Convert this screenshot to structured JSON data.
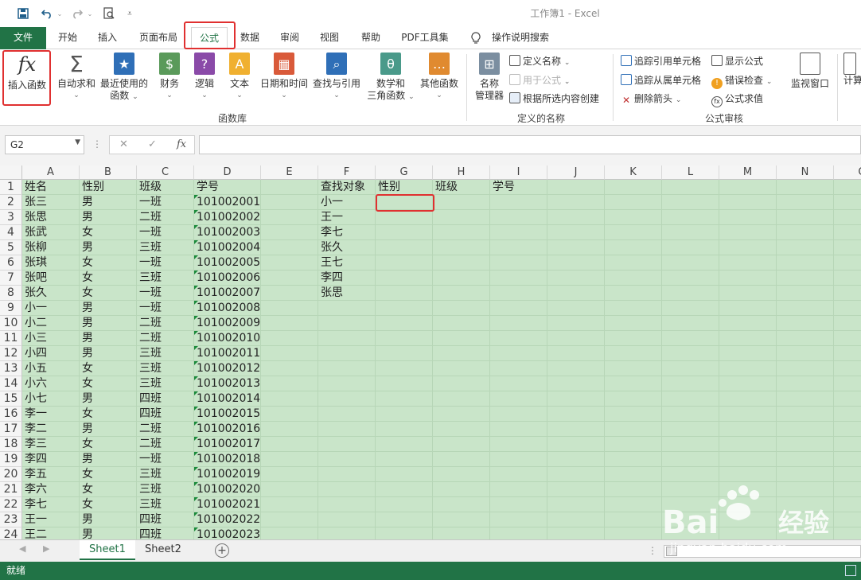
{
  "app": {
    "title": "工作簿1  -  Excel"
  },
  "quick_access": {
    "save": "save-icon",
    "undo": "undo-icon",
    "redo": "redo-icon",
    "preview": "print-preview-icon",
    "customize": "customize-icon"
  },
  "tabs": [
    "文件",
    "开始",
    "插入",
    "页面布局",
    "公式",
    "数据",
    "审阅",
    "视图",
    "帮助",
    "PDF工具集"
  ],
  "active_tab": "公式",
  "tell_me": "操作说明搜索",
  "ribbon": {
    "function_library": {
      "label": "函数库",
      "insert_function": "插入函数",
      "autosum": "自动求和",
      "recent_line1": "最近使用的",
      "recent_line2": "函数",
      "financial": "财务",
      "logical": "逻辑",
      "text": "文本",
      "datetime": "日期和时间",
      "lookup": "查找与引用",
      "math_line1": "数学和",
      "math_line2": "三角函数",
      "more": "其他函数"
    },
    "defined_names": {
      "label": "定义的名称",
      "name_manager_line1": "名称",
      "name_manager_line2": "管理器",
      "define_name": "定义名称",
      "use_in_formula": "用于公式",
      "create_from_selection": "根据所选内容创建"
    },
    "formula_auditing": {
      "label": "公式审核",
      "trace_precedents": "追踪引用单元格",
      "trace_dependents": "追踪从属单元格",
      "remove_arrows": "删除箭头",
      "show_formulas": "显示公式",
      "error_checking": "错误检查",
      "evaluate_formula": "公式求值",
      "watch_window": "监视窗口",
      "calc_partial": "计算"
    }
  },
  "formula_bar": {
    "name_box": "G2",
    "cancel": "✕",
    "enter": "✓",
    "fx": "fx",
    "value": ""
  },
  "columns": [
    "A",
    "B",
    "C",
    "D",
    "E",
    "F",
    "G",
    "H",
    "I",
    "J",
    "K",
    "L",
    "M",
    "N",
    "O"
  ],
  "rows": [
    {
      "n": "1",
      "A": "姓名",
      "B": "性别",
      "C": "班级",
      "D": "学号",
      "F": "查找对象",
      "G": "性别",
      "H": "班级",
      "I": "学号"
    },
    {
      "n": "2",
      "A": "张三",
      "B": "男",
      "C": "一班",
      "D": "101002001",
      "F": "小一"
    },
    {
      "n": "3",
      "A": "张思",
      "B": "男",
      "C": "二班",
      "D": "101002002",
      "F": "王一"
    },
    {
      "n": "4",
      "A": "张武",
      "B": "女",
      "C": "一班",
      "D": "101002003",
      "F": "李七"
    },
    {
      "n": "5",
      "A": "张柳",
      "B": "男",
      "C": "三班",
      "D": "101002004",
      "F": "张久"
    },
    {
      "n": "6",
      "A": "张琪",
      "B": "女",
      "C": "一班",
      "D": "101002005",
      "F": "王七"
    },
    {
      "n": "7",
      "A": "张吧",
      "B": "女",
      "C": "三班",
      "D": "101002006",
      "F": "李四"
    },
    {
      "n": "8",
      "A": "张久",
      "B": "女",
      "C": "一班",
      "D": "101002007",
      "F": "张思"
    },
    {
      "n": "9",
      "A": "小一",
      "B": "男",
      "C": "一班",
      "D": "101002008"
    },
    {
      "n": "10",
      "A": "小二",
      "B": "男",
      "C": "二班",
      "D": "101002009"
    },
    {
      "n": "11",
      "A": "小三",
      "B": "男",
      "C": "二班",
      "D": "101002010"
    },
    {
      "n": "12",
      "A": "小四",
      "B": "男",
      "C": "三班",
      "D": "101002011"
    },
    {
      "n": "13",
      "A": "小五",
      "B": "女",
      "C": "三班",
      "D": "101002012"
    },
    {
      "n": "14",
      "A": "小六",
      "B": "女",
      "C": "三班",
      "D": "101002013"
    },
    {
      "n": "15",
      "A": "小七",
      "B": "男",
      "C": "四班",
      "D": "101002014"
    },
    {
      "n": "16",
      "A": "李一",
      "B": "女",
      "C": "四班",
      "D": "101002015"
    },
    {
      "n": "17",
      "A": "李二",
      "B": "男",
      "C": "二班",
      "D": "101002016"
    },
    {
      "n": "18",
      "A": "李三",
      "B": "女",
      "C": "二班",
      "D": "101002017"
    },
    {
      "n": "19",
      "A": "李四",
      "B": "男",
      "C": "一班",
      "D": "101002018"
    },
    {
      "n": "20",
      "A": "李五",
      "B": "女",
      "C": "三班",
      "D": "101002019"
    },
    {
      "n": "21",
      "A": "李六",
      "B": "女",
      "C": "三班",
      "D": "101002020"
    },
    {
      "n": "22",
      "A": "李七",
      "B": "女",
      "C": "三班",
      "D": "101002021"
    },
    {
      "n": "23",
      "A": "王一",
      "B": "男",
      "C": "四班",
      "D": "101002022"
    },
    {
      "n": "24",
      "A": "王二",
      "B": "男",
      "C": "四班",
      "D": "101002023"
    }
  ],
  "selected_cell": "G2",
  "sheets": [
    "Sheet1",
    "Sheet2"
  ],
  "active_sheet": "Sheet1",
  "status": "就绪",
  "watermark": {
    "brand": "Bai",
    "brand2": "经验",
    "url": "jingyan.baidu.com"
  },
  "colors": {
    "excel_green": "#217346",
    "cell_fill": "#c9e5c9",
    "highlight": "#e03030"
  }
}
